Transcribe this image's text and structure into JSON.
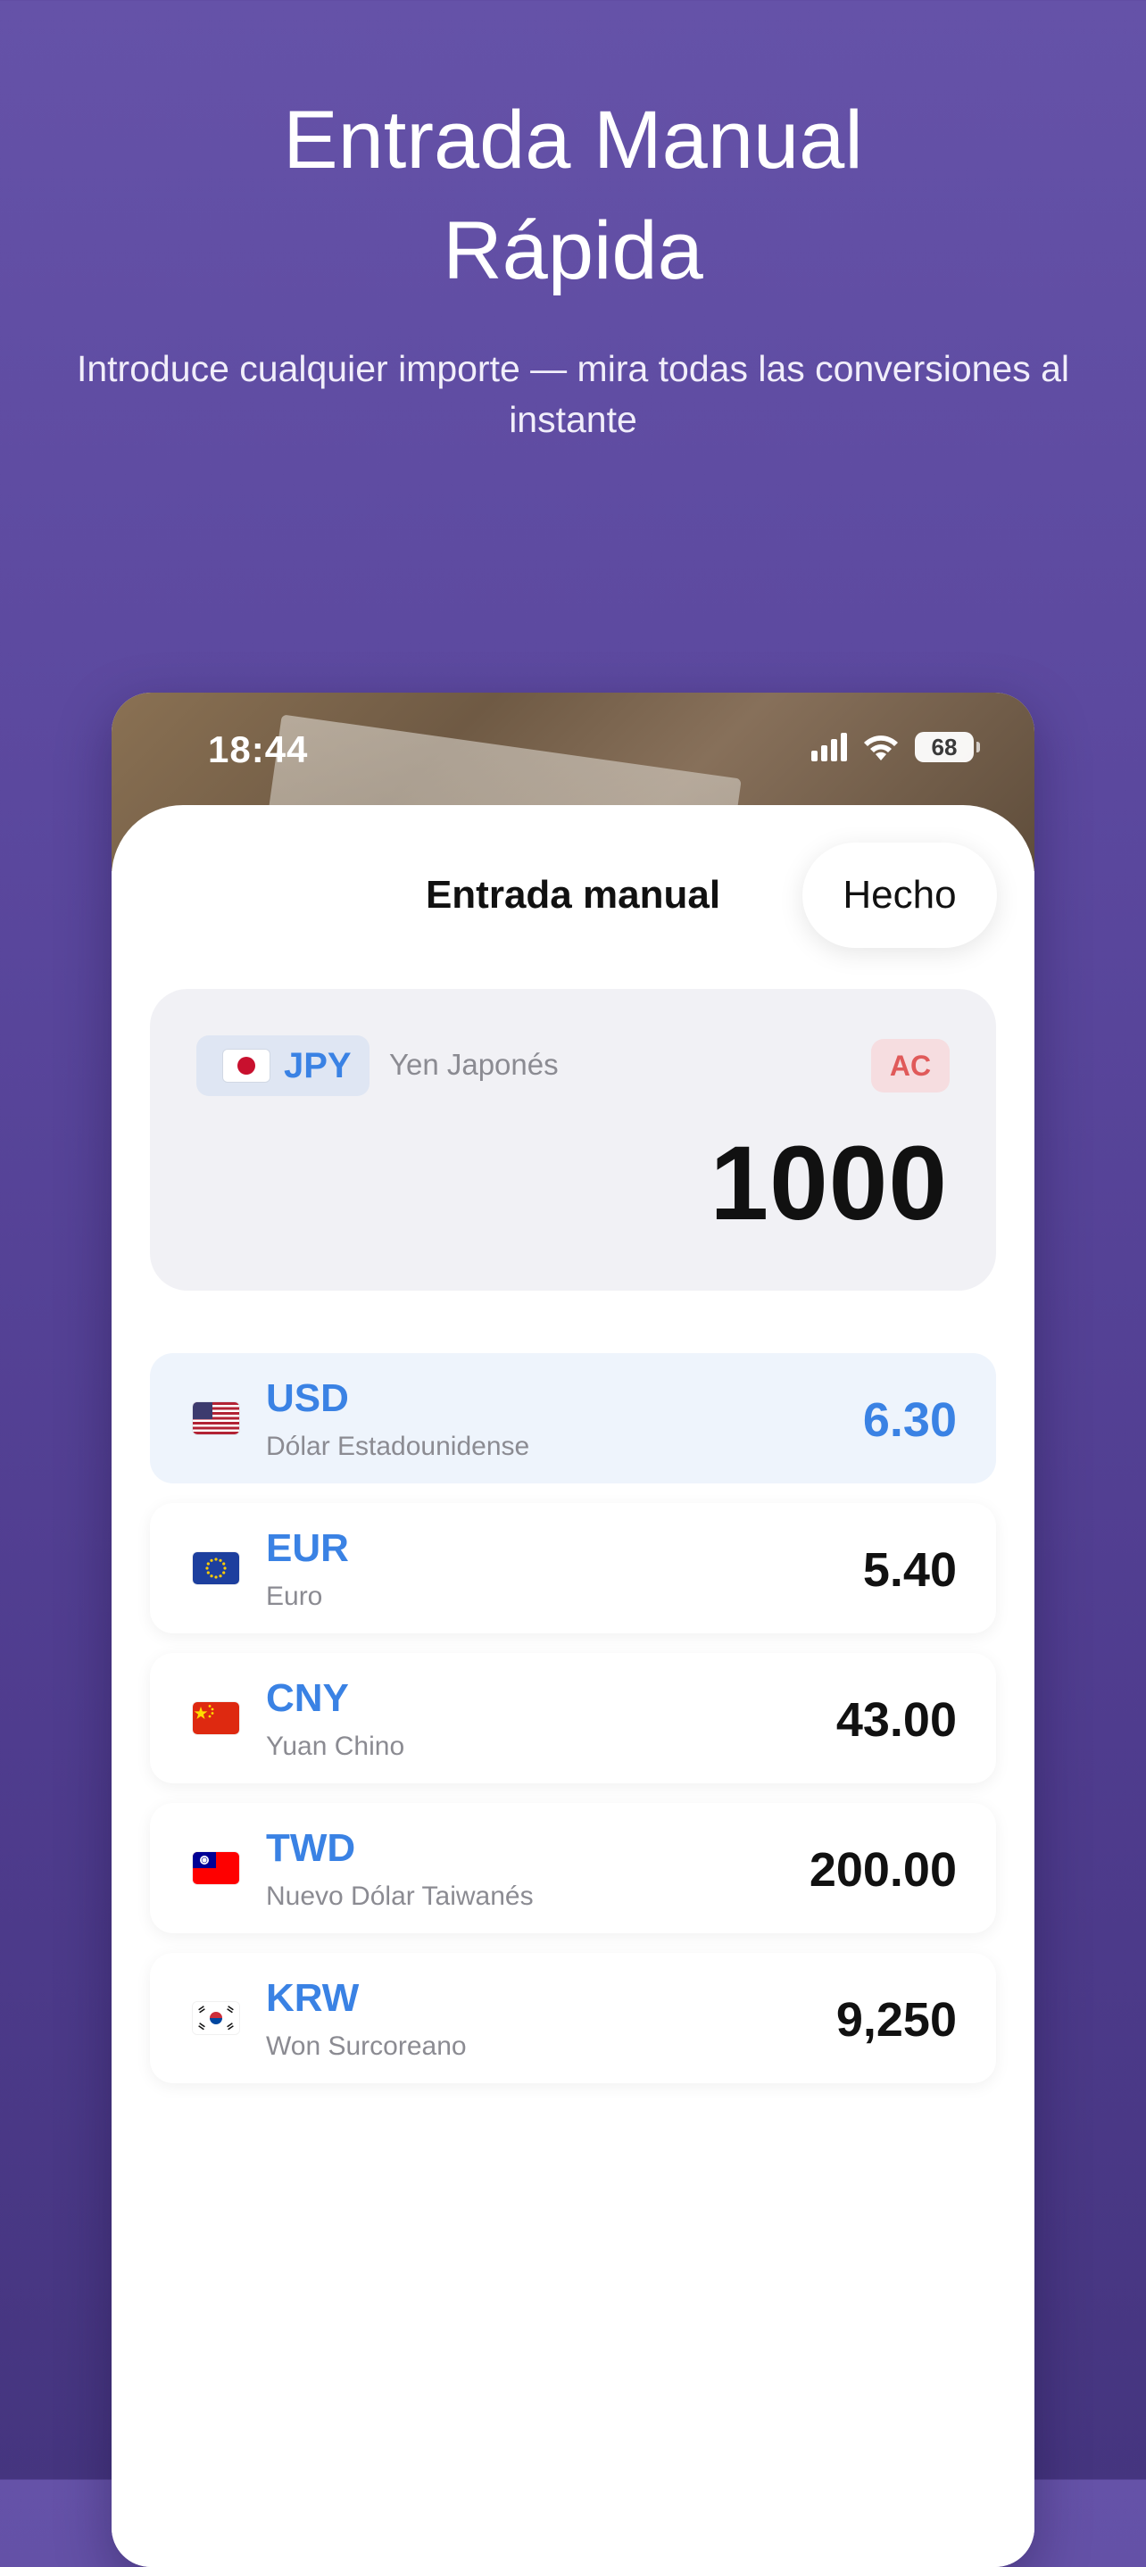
{
  "hero": {
    "title": "Entrada Manual Rápida",
    "subtitle": "Introduce cualquier importe — mira todas las conversiones al instante"
  },
  "status_bar": {
    "time": "18:44",
    "battery": "68",
    "icons": [
      "signal-icon",
      "wifi-icon",
      "battery-icon"
    ]
  },
  "sheet": {
    "title": "Entrada manual",
    "done_label": "Hecho"
  },
  "input": {
    "flag": "jp-flag-icon",
    "code": "JPY",
    "name": "Yen Japonés",
    "clear_label": "AC",
    "amount": "1000"
  },
  "rates": [
    {
      "flag": "us-flag-icon",
      "code": "USD",
      "name": "Dólar Estadounidense",
      "value": "6.30",
      "selected": true
    },
    {
      "flag": "eu-flag-icon",
      "code": "EUR",
      "name": "Euro",
      "value": "5.40",
      "selected": false
    },
    {
      "flag": "cn-flag-icon",
      "code": "CNY",
      "name": "Yuan Chino",
      "value": "43.00",
      "selected": false
    },
    {
      "flag": "tw-flag-icon",
      "code": "TWD",
      "name": "Nuevo Dólar Taiwanés",
      "value": "200.00",
      "selected": false
    },
    {
      "flag": "kr-flag-icon",
      "code": "KRW",
      "name": "Won Surcoreano",
      "value": "9,250",
      "selected": false
    }
  ],
  "colors": {
    "accent": "#3a82e4",
    "background_top": "#6552a8",
    "background_bottom": "#45357f",
    "clear_button": "#e05a5a"
  }
}
